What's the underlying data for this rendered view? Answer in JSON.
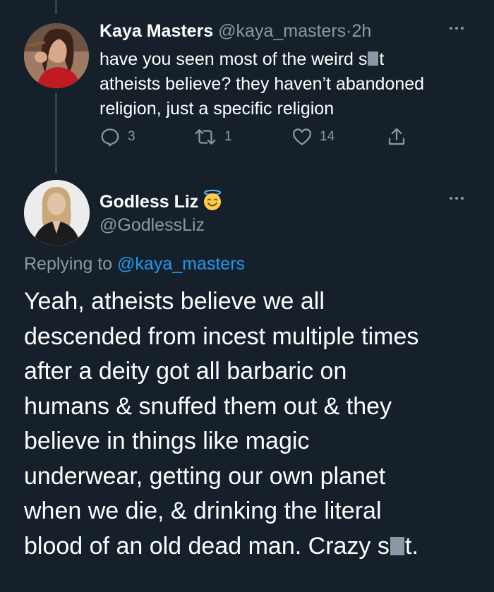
{
  "tweet1": {
    "name": "Kaya Masters",
    "handle": "@kaya_masters",
    "separator": "·",
    "time": "2h",
    "text_part1": "have you seen most of the weird s",
    "text_part2": "t",
    "text_line2": "atheists believe? they haven’t abandoned",
    "text_line3": "religion, just a specific religion",
    "replies": "3",
    "retweets": "1",
    "likes": "14"
  },
  "tweet2": {
    "name": "Godless Liz",
    "handle": "@GodlessLiz",
    "replying_prefix": "Replying to ",
    "replying_to": "@kaya_masters",
    "lines": [
      "Yeah, atheists believe we all",
      "descended from incest multiple times",
      "after a deity got all barbaric on",
      "humans & snuffed them out & they",
      "believe in things like magic",
      "underwear, getting our own planet",
      "when we die, & drinking the literal"
    ],
    "last_line_part1": "blood of an old dead man. Crazy s",
    "last_line_part2": "t."
  },
  "icons": {
    "reply": "reply-icon",
    "retweet": "retweet-icon",
    "like": "heart-icon",
    "share": "share-icon",
    "more": "more-icon",
    "emoji": "smiling-face-with-halo-emoji"
  },
  "colors": {
    "background": "#15202b",
    "secondary_text": "#8b98a5",
    "link": "#1d9bf0",
    "thread_line": "#38444d"
  }
}
